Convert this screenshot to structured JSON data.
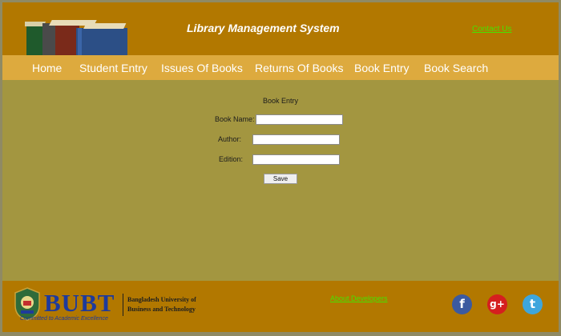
{
  "header": {
    "title": "Library Management System",
    "contact_label": "Contact Us"
  },
  "nav": {
    "items": [
      {
        "label": "Home"
      },
      {
        "label": "Student Entry"
      },
      {
        "label": "Issues Of Books"
      },
      {
        "label": "Returns Of Books"
      },
      {
        "label": "Book Entry"
      },
      {
        "label": "Book Search"
      }
    ]
  },
  "form": {
    "title": "Book Entry",
    "book_name_label": "Book Name:",
    "book_name_value": "",
    "author_label": "Author:",
    "author_value": "",
    "edition_label": "Edition:",
    "edition_value": "",
    "save_label": "Save"
  },
  "footer": {
    "logo_text": "BUBT",
    "university_line1": "Bangladesh University of",
    "university_line2": "Business and Technology",
    "tagline": "Committed to Academic Excellence",
    "about_label": "About Developers",
    "social": [
      {
        "icon": "facebook-icon",
        "glyph": "f",
        "color": "#3b5aa0"
      },
      {
        "icon": "google-plus-icon",
        "glyph": "g+",
        "color": "#d51f1f"
      },
      {
        "icon": "twitter-icon",
        "glyph": "t",
        "color": "#3ea6dd"
      }
    ]
  },
  "colors": {
    "header_bg": "#b27800",
    "nav_bg": "#ddaa3e",
    "content_bg": "#a39640",
    "link_green": "#46e400"
  }
}
